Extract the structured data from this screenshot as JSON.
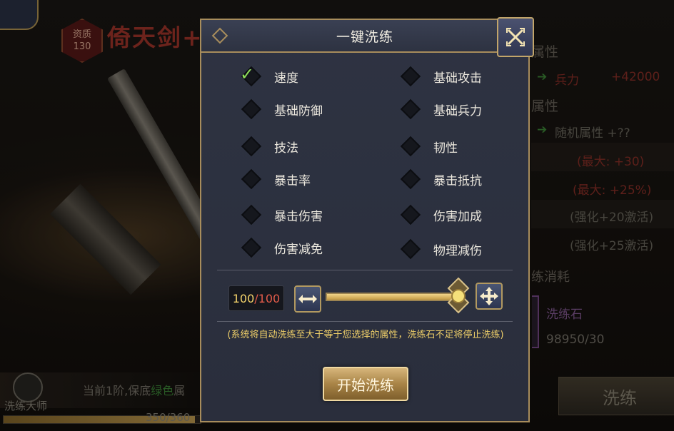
{
  "background": {
    "grade_badge": {
      "label": "资质",
      "value": "130"
    },
    "weapon_name": "倚天剑+",
    "right_panel": {
      "section1": "属性",
      "attr1_name": "兵力",
      "attr1_value": "+42000",
      "section2": "属性",
      "random_attr": "随机属性 +??",
      "max1": "(最大: +30)",
      "max2": "(最大: +25%)",
      "enhance1": "(强化+20激活)",
      "enhance2": "(强化+25激活)",
      "consume_title": "练消耗",
      "stone_name": "洗练石",
      "stone_count": "98950/30",
      "wash_button": "洗练"
    },
    "bottom": {
      "master_label": "洗练大师",
      "tier_prefix": "当前1阶,保底",
      "tier_green": "绿色",
      "tier_suffix": "属",
      "progress_text": "350/360",
      "progress_ratio": 0.972
    }
  },
  "modal": {
    "title": "一键洗练",
    "options": [
      {
        "label": "速度",
        "checked": true
      },
      {
        "label": "基础攻击",
        "checked": false
      },
      {
        "label": "基础防御",
        "checked": false
      },
      {
        "label": "基础兵力",
        "checked": false
      },
      {
        "label": "技法",
        "checked": false
      },
      {
        "label": "韧性",
        "checked": false
      },
      {
        "label": "暴击率",
        "checked": false
      },
      {
        "label": "暴击抵抗",
        "checked": false
      },
      {
        "label": "暴击伤害",
        "checked": false
      },
      {
        "label": "伤害加成",
        "checked": false
      },
      {
        "label": "伤害减免",
        "checked": false
      },
      {
        "label": "物理减伤",
        "checked": false
      }
    ],
    "count_current": "100",
    "count_sep": "/",
    "count_max": "100",
    "slider_ratio": 1.0,
    "note": "(系统将自动洗练至大于等于您选择的属性，洗练石不足将停止洗练)",
    "start_button": "开始洗练"
  },
  "colors": {
    "accent_gold": "#a88d5c",
    "check_green": "#8ee05a",
    "note_yellow": "#f0d069",
    "count_red": "#e25b4a"
  }
}
